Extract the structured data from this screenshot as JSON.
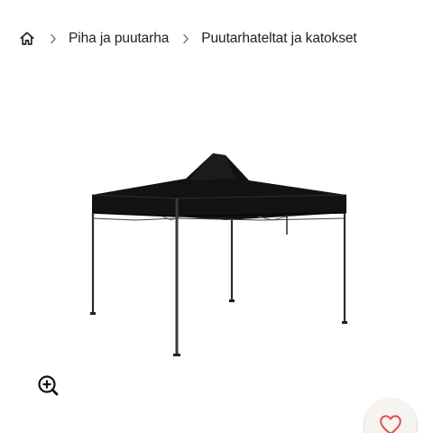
{
  "breadcrumb": {
    "home_icon": "home-icon",
    "separator_icon": "chevron-right-icon",
    "items": [
      {
        "label": "Piha ja puutarha"
      },
      {
        "label": "Puutarhateltat ja katokset"
      }
    ]
  },
  "product": {
    "image_icon": "black-pop-up-gazebo-image"
  },
  "controls": {
    "zoom_icon": "zoom-in-icon",
    "favorite_icon": "heart-icon"
  },
  "colors": {
    "text": "#1f1f1f",
    "favorite_heart": "#d9534f",
    "favorite_bg": "#f6f3f1",
    "canopy": "#111111"
  }
}
